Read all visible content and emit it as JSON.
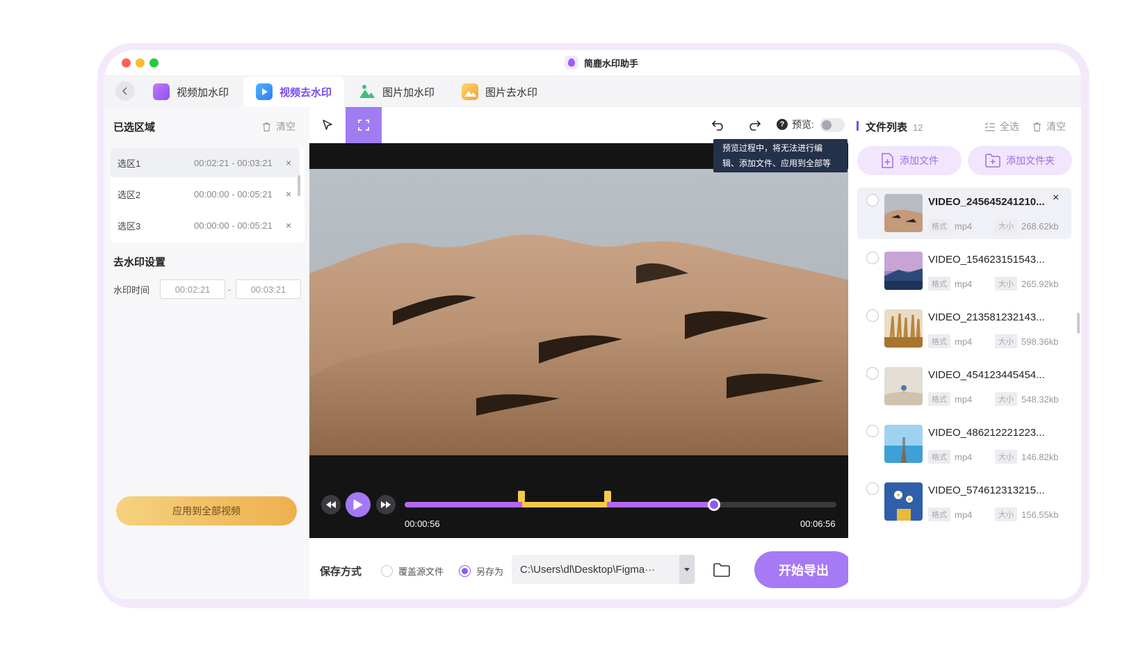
{
  "app": {
    "title": "简鹿水印助手"
  },
  "tabs": [
    {
      "label": "视频加水印",
      "active": false
    },
    {
      "label": "视频去水印",
      "active": true
    },
    {
      "label": "图片加水印",
      "active": false
    },
    {
      "label": "图片去水印",
      "active": false
    }
  ],
  "left_panel": {
    "selected_title": "已选区域",
    "clear_label": "清空",
    "regions": [
      {
        "name": "选区1",
        "start": "00:02:21",
        "end": "00:03:21"
      },
      {
        "name": "选区2",
        "start": "00:00:00",
        "end": "00:05:21"
      },
      {
        "name": "选区3",
        "start": "00:00:00",
        "end": "00:05:21"
      }
    ],
    "time_separator": "-",
    "settings_title": "去水印设置",
    "wm_time_label": "水印时间",
    "wm_time_start": "00:02:21",
    "wm_time_end": "00:03:21",
    "apply_label": "应用到全部视频"
  },
  "toolbar": {
    "preview_label": "预览:",
    "help_glyph": "?",
    "preview_enabled": false,
    "tooltip": "预览过程中，将无法进行编辑、添加文件、应用到全部等"
  },
  "player": {
    "current_time": "00:00:56",
    "total_time": "00:06:56",
    "progress_fraction": 0.717,
    "selection_start_fraction": 0.272,
    "selection_end_fraction": 0.468
  },
  "save": {
    "label": "保存方式",
    "option_overwrite": "覆盖源文件",
    "option_save_as": "另存为",
    "selected": "save_as",
    "path": "C:\\Users\\dl\\Desktop\\Figma···",
    "export_label": "开始导出"
  },
  "file_list": {
    "title": "文件列表",
    "count": "12",
    "select_all_label": "全选",
    "clear_label": "清空",
    "add_file_label": "添加文件",
    "add_folder_label": "添加文件夹",
    "format_tag": "格式",
    "size_tag": "大小",
    "close_glyph": "×",
    "items": [
      {
        "name": "VIDEO_245645241210...",
        "format": "mp4",
        "size": "268.62kb"
      },
      {
        "name": "VIDEO_154623151543...",
        "format": "mp4",
        "size": "265.92kb"
      },
      {
        "name": "VIDEO_213581232143...",
        "format": "mp4",
        "size": "598.36kb"
      },
      {
        "name": "VIDEO_454123445454...",
        "format": "mp4",
        "size": "548.32kb"
      },
      {
        "name": "VIDEO_486212221223...",
        "format": "mp4",
        "size": "146.82kb"
      },
      {
        "name": "VIDEO_574612313215...",
        "format": "mp4",
        "size": "156.55kb"
      }
    ]
  },
  "colors": {
    "accent": "#8a5cf5",
    "selection": "#f7c948",
    "apply_button": "#eeb04e"
  }
}
